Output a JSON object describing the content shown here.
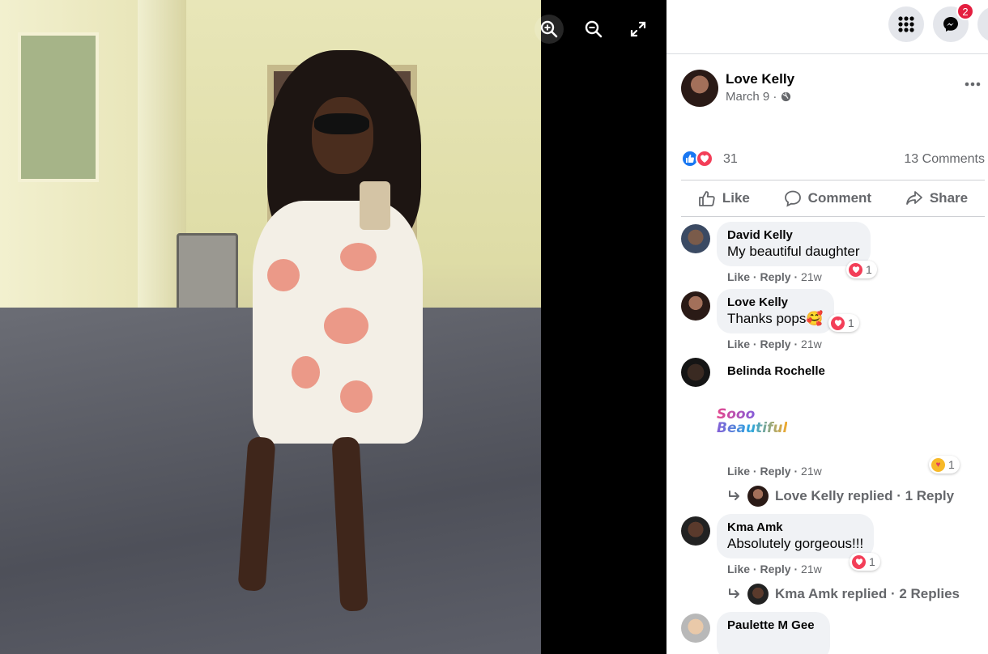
{
  "viewer": {
    "zoom_in_label": "zoom-in",
    "zoom_out_label": "zoom-out",
    "fullscreen_label": "fullscreen"
  },
  "topbar": {
    "messenger_badge": "2"
  },
  "post": {
    "author": "Love Kelly",
    "date": "March 9",
    "separator": " · ",
    "reaction_count": "31",
    "comment_count": "13 Comments",
    "actions": {
      "like": "Like",
      "comment": "Comment",
      "share": "Share"
    }
  },
  "comments": [
    {
      "name": "David Kelly",
      "text": "My beautiful daughter",
      "like": "Like",
      "reply": "Reply",
      "time": "21w",
      "reactions": "1"
    },
    {
      "name": "Love Kelly",
      "text": "Thanks pops🥰",
      "like": "Like",
      "reply": "Reply",
      "time": "21w",
      "reactions": "1"
    },
    {
      "name": "Belinda Rochelle",
      "sticker_text": "Sooo Beautiful",
      "like": "Like",
      "reply": "Reply",
      "time": "21w",
      "reactions": "1",
      "replies": "Love Kelly replied · 1 Reply"
    },
    {
      "name": "Kma Amk",
      "text": "Absolutely gorgeous!!!",
      "like": "Like",
      "reply": "Reply",
      "time": "21w",
      "reactions": "1",
      "replies": "Kma Amk replied · 2 Replies"
    },
    {
      "name": "Paulette M Gee"
    }
  ],
  "colors": {
    "like_blue": "#1877f2",
    "love_red": "#f33e58",
    "badge_red": "#e41e3f"
  }
}
